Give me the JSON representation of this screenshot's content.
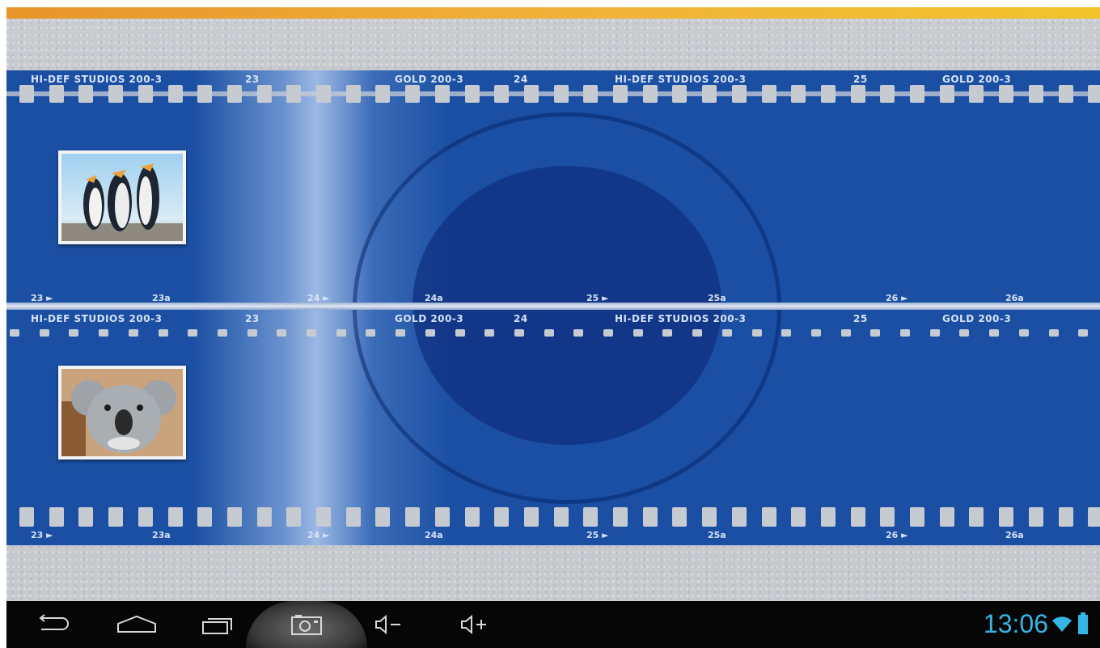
{
  "film": {
    "edge_top": [
      "HI-DEF STUDIOS 200-3",
      "23",
      "GOLD 200-3",
      "24",
      "HI-DEF STUDIOS 200-3",
      "25",
      "GOLD 200-3"
    ],
    "edge_mid": [
      "HI-DEF STUDIOS 200-3",
      "23",
      "GOLD 200-3",
      "24",
      "HI-DEF STUDIOS 200-3",
      "25",
      "GOLD 200-3"
    ],
    "frames_row": [
      "23 ►",
      "23a",
      "24 ►",
      "24a",
      "25 ►",
      "25a",
      "26 ►",
      "26a"
    ],
    "frames_bottom": [
      "23 ►",
      "23a",
      "24 ►",
      "24a",
      "25 ►",
      "25a",
      "26 ►",
      "26a"
    ]
  },
  "thumbnails": [
    {
      "subject": "penguins"
    },
    {
      "subject": "koala"
    }
  ],
  "navbar": {
    "buttons": [
      "back-icon",
      "home-icon",
      "recent-apps-icon",
      "screenshot-icon",
      "volume-down-icon",
      "volume-up-icon"
    ],
    "clock": "13:06"
  },
  "colors": {
    "film_blue": "#1a4fa3",
    "accent_bar": "#f0b43a",
    "clock": "#35b5e5"
  }
}
